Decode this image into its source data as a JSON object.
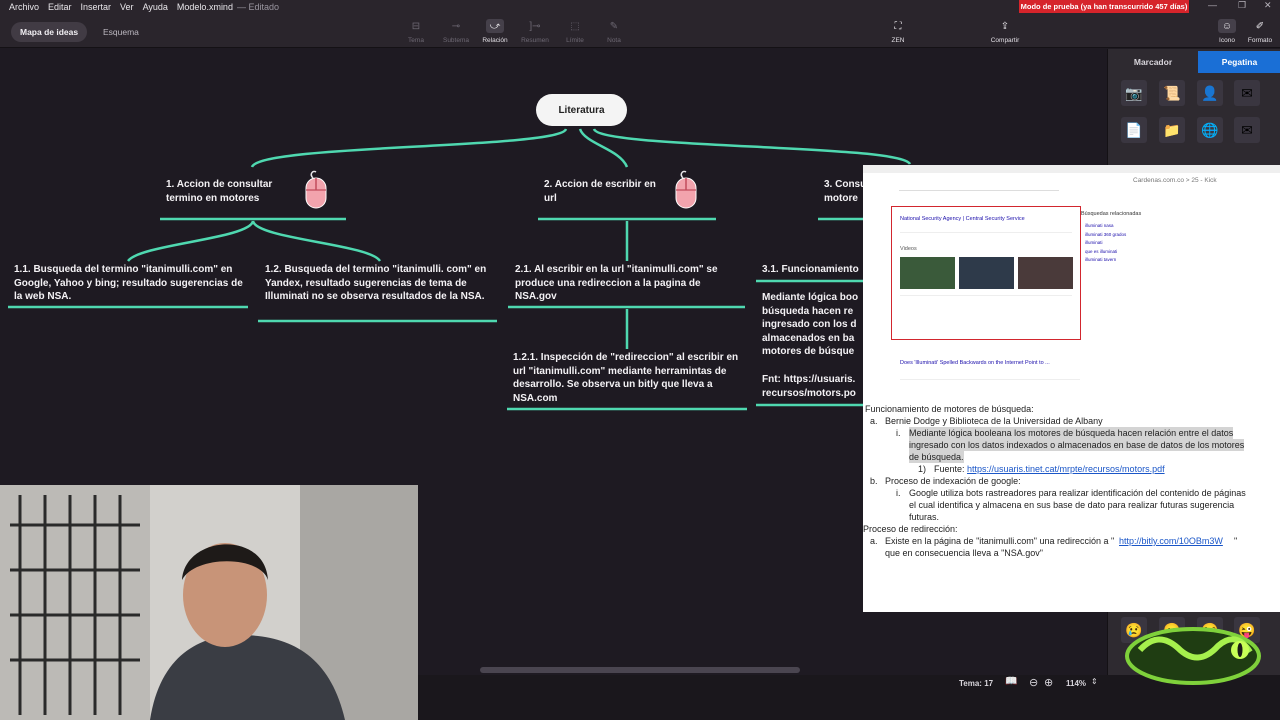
{
  "menu": {
    "items": [
      "Archivo",
      "Editar",
      "Insertar",
      "Ver",
      "Ayuda"
    ],
    "doc_title": "Modelo.xmind",
    "doc_state": "— Editado",
    "trial_banner": "Modo de prueba (ya han transcurrido 457 días)"
  },
  "toolbar": {
    "view_tabs": [
      "Mapa de ideas",
      "Esquema"
    ],
    "tools": [
      "Tema",
      "Subtema",
      "Relación",
      "Resumen",
      "Límite",
      "Nota"
    ],
    "zen": "ZEN",
    "share": "Compartir",
    "icon": "Icono",
    "format": "Formato"
  },
  "map": {
    "central": "Literatura",
    "branch1": "1. Accion de consultar termino en motores",
    "branch2": "2. Accion de escribir en url",
    "branch3": "3. Consu motore",
    "b1_1": "1.1.  Busqueda del termino \"itanimulli.com\" en Google, Yahoo y bing; resultado sugerencias de la web NSA.",
    "b1_2": "1.2.  Busqueda del termino \"itanimulli. com\" en Yandex, resultado sugerencias de tema de Illuminati no se observa resultados de la NSA.",
    "b2_1": "2.1. Al escribir en la url \"itanimulli.com\" se produce una redireccion a la pagina de NSA.gov",
    "b2_1_1": "1.2.1. Inspección de \"redireccion\" al escribir en url \"itanimulli.com\" mediante herramintas de desarrollo. Se observa un bitly que lleva a NSA.com",
    "b3_1": "3.1. Funcionamiento",
    "b3_1_text": "Mediante lógica boo búsqueda hacen re ingresado con los d almacenados en ba motores de búsque",
    "b3_1_source": "Fnt: https://usuaris. recursos/motors.po"
  },
  "rpanel": {
    "tabs": [
      "Marcador",
      "Pegatina"
    ]
  },
  "status": {
    "topic": "Tema: 17",
    "zoom": "114%"
  },
  "overlay": {
    "tab_text": "Cardenas.com.co > 25 - Kick",
    "result_title": "National Security Agency | Central Security Service",
    "videos_label": "Videos",
    "related_label": "Búsquedas relacionadas",
    "related": [
      "illuminati nasa",
      "illuminati 360 grados",
      "illuminati",
      "que es illuminati",
      "illuminati tavern"
    ],
    "second_result": "Does 'Illuminati' Spelled Backwards on the Internet Point to ...",
    "doc": {
      "l1": "Funcionamiento de motores de búsqueda:",
      "l2a": "a.",
      "l2": "Bernie Dodge y Biblioteca de la Universidad de Albany",
      "l3i": "i.",
      "l3": "Mediante lógica booleana los motores de búsqueda hacen relación entre el datos",
      "l4": "ingresado con los datos indexados o almacenados en base de datos de los motores",
      "l5": "de búsqueda.",
      "l6n": "1)",
      "l6": "Fuente: ",
      "l6link": "https://usuaris.tinet.cat/mrpte/recursos/motors.pdf",
      "l7a": "b.",
      "l7": "Proceso de indexación de google:",
      "l8i": "i.",
      "l8": "Google utiliza bots rastreadores para realizar identificación del contenido de páginas",
      "l9": "el cual identifica y almacena en sus base de dato para realizar futuras sugerencia",
      "l10": "futuras.",
      "l11": "Proceso de redirección:",
      "l12a": "a.",
      "l12": "Existe en la página de \"itanimulli.com\" una redirección a \"",
      "l12link": "http://bitly.com/10OBm3W",
      "l12end": "\"",
      "l13": "que en consecuencia lleva a \"NSA.gov\""
    }
  },
  "colors": {
    "branch_line": "#4fd8b0",
    "accent_blue": "#1a6fd6",
    "trial_red": "#d6242b"
  }
}
